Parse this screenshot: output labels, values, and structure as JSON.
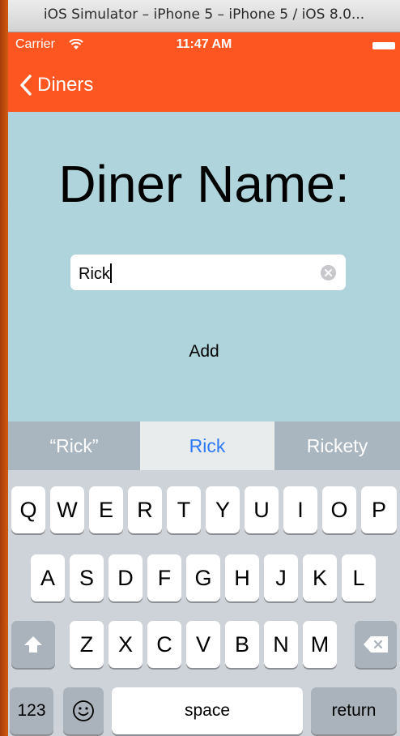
{
  "window": {
    "title": "iOS Simulator – iPhone 5 – iPhone 5 / iOS 8.0..."
  },
  "status_bar": {
    "carrier": "Carrier",
    "time": "11:47 AM"
  },
  "navbar": {
    "back_label": "Diners"
  },
  "form": {
    "heading": "Diner Name:",
    "name_value": "Rick",
    "add_label": "Add"
  },
  "suggestions": {
    "quoted": "“Rick”",
    "selected": "Rick",
    "alternate": "Rickety"
  },
  "keyboard": {
    "row1": [
      "Q",
      "W",
      "E",
      "R",
      "T",
      "Y",
      "U",
      "I",
      "O",
      "P"
    ],
    "row2": [
      "A",
      "S",
      "D",
      "F",
      "G",
      "H",
      "J",
      "K",
      "L"
    ],
    "row3": [
      "Z",
      "X",
      "C",
      "V",
      "B",
      "N",
      "M"
    ],
    "numbers_label": "123",
    "space_label": "space",
    "return_label": "return"
  },
  "colors": {
    "nav_accent": "#fd5621",
    "content_bg": "#b0d4dc",
    "suggestion_selected_text": "#2f7bf5"
  },
  "icons": [
    "wifi-icon",
    "battery-icon",
    "back-chevron-icon",
    "clear-icon",
    "shift-icon",
    "delete-icon",
    "emoji-icon"
  ]
}
